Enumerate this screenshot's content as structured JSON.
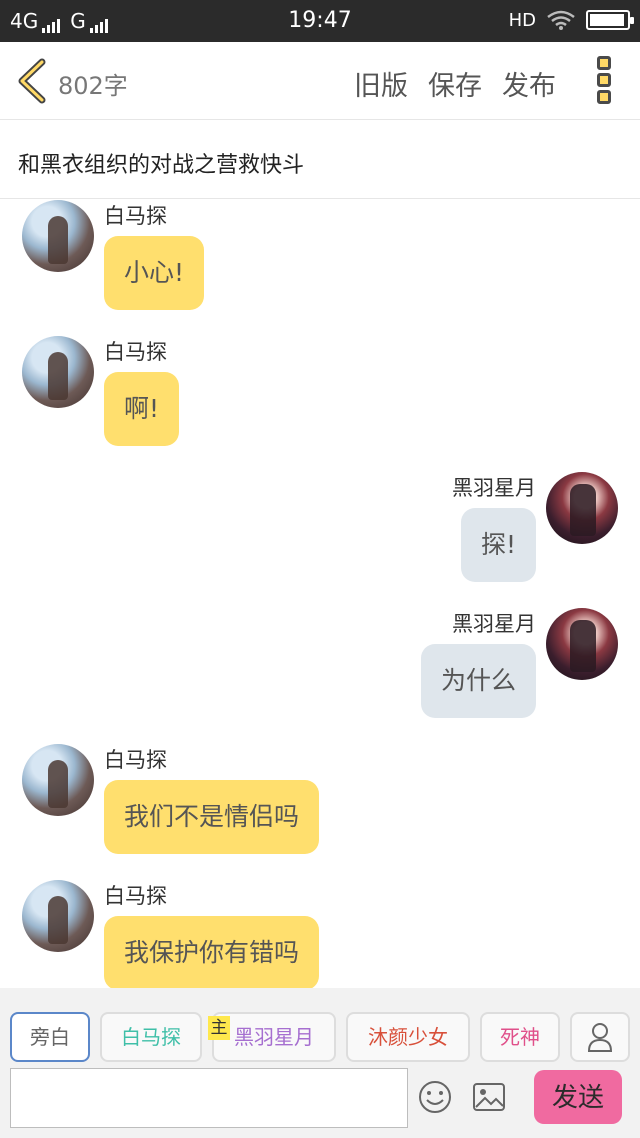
{
  "status_bar": {
    "network_1": "4G",
    "network_2": "G",
    "time": "19:47",
    "hd": "HD",
    "battery_level": 0.95
  },
  "header": {
    "word_count": "802字",
    "old_version_label": "旧版",
    "save_label": "保存",
    "publish_label": "发布"
  },
  "story_title": "和黑衣组织的对战之营救快斗",
  "messages": [
    {
      "name": "白马探",
      "text": "小心!",
      "side": "left"
    },
    {
      "name": "白马探",
      "text": "啊!",
      "side": "left"
    },
    {
      "name": "黑羽星月",
      "text": "探!",
      "side": "right"
    },
    {
      "name": "黑羽星月",
      "text": "为什么",
      "side": "right"
    },
    {
      "name": "白马探",
      "text": "我们不是情侣吗",
      "side": "left"
    },
    {
      "name": "白马探",
      "text": "我保护你有错吗",
      "side": "left"
    }
  ],
  "roles": [
    {
      "label": "旁白",
      "color": "#666666"
    },
    {
      "label": "白马探",
      "color": "#3fbfa8"
    },
    {
      "label": "黑羽星月",
      "color": "#a66fd0"
    },
    {
      "label": "沐颜少女",
      "color": "#d8503a"
    },
    {
      "label": "死神",
      "color": "#e0508a"
    }
  ],
  "main_badge": "主",
  "composer": {
    "placeholder": "",
    "send_label": "发送"
  },
  "colors": {
    "left_bubble": "#ffdf6e",
    "right_bubble": "#dfe6ec",
    "send_button": "#f06aa0",
    "active_role_border": "#5b87c9"
  }
}
